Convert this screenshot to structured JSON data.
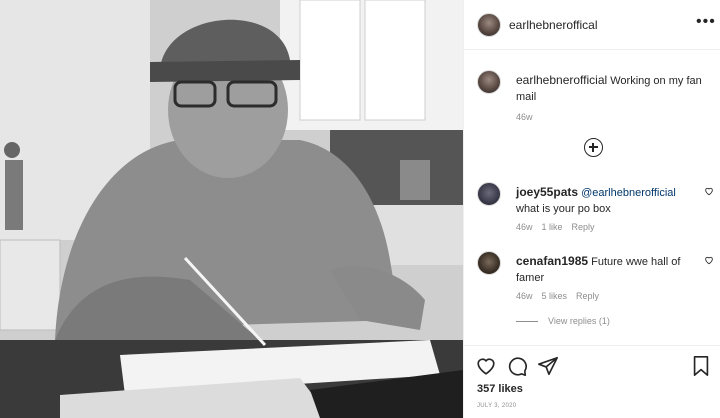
{
  "post": {
    "author": "earlhebneroffical",
    "more_icon": "more-horizontal-icon",
    "caption_author": "earlhebnerofficial",
    "caption_text": "Working on my fan mail",
    "caption_time": "46w",
    "load_more_icon": "plus-circle-icon",
    "comments": [
      {
        "username": "joey55pats",
        "mention": "@earlhebnerofficial",
        "text": "what is your po box",
        "time": "46w",
        "likes": "1 like",
        "reply": "Reply"
      },
      {
        "username": "cenafan1985",
        "text": "Future wwe hall of famer",
        "time": "46w",
        "likes": "5 likes",
        "reply": "Reply",
        "view_replies": "View replies (1)"
      }
    ],
    "actions": {
      "like_icon": "heart-icon",
      "comment_icon": "comment-icon",
      "share_icon": "send-icon",
      "save_icon": "bookmark-icon"
    },
    "likes_count": "357 likes",
    "date": "JULY 3, 2020"
  }
}
